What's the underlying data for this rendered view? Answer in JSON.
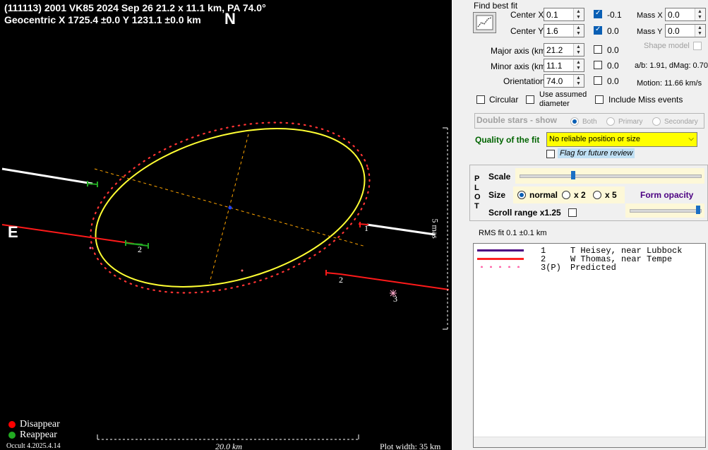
{
  "plot": {
    "title": "(111113) 2001 VK85  2024 Sep 26  21.2 x 11.1 km, PA 74.0°",
    "geocentric": "Geocentric  X  1725.4 ±0.0  Y 1231.1 ±0.0 km",
    "north_label": "N",
    "east_label": "E",
    "scale_label": "5 mas",
    "chord_labels": [
      "1",
      "2",
      "1",
      "2",
      "3"
    ],
    "legend_disappear": "Disappear",
    "legend_reappear": "Reappear",
    "version": "Occult 4.2025.4.14",
    "scale_bar_label": "20.0 km",
    "plot_width": "Plot width: 35 km",
    "colors": {
      "background": "#000000",
      "ellipse": "#ffff33",
      "chord1": "#ffffff",
      "chord2": "#ff1a1a",
      "predicted": "#ff3333",
      "axis_dash": "#ffa500",
      "disappear": "#ff0000",
      "reappear": "#22aa22"
    }
  },
  "panel": {
    "find_best_fit": "Find best fit",
    "center_x": {
      "label": "Center X",
      "value": "0.1",
      "check": true,
      "adj": "-0.1"
    },
    "center_y": {
      "label": "Center Y",
      "value": "1.6",
      "check": true,
      "adj": "0.0"
    },
    "mass_x": {
      "label": "Mass X",
      "value": "0.0"
    },
    "mass_y": {
      "label": "Mass Y",
      "value": "0.0"
    },
    "shape_model": "Shape model",
    "major_axis": {
      "label": "Major axis (km)",
      "value": "21.2",
      "check": false,
      "adj": "0.0"
    },
    "minor_axis": {
      "label": "Minor axis (km)",
      "value": "11.1",
      "check": false,
      "adj": "0.0"
    },
    "orientation": {
      "label": "Orientation",
      "value": "74.0",
      "check": false,
      "adj": "0.0"
    },
    "ab_dmag": "a/b: 1.91, dMag: 0.70",
    "motion": "Motion: 11.66 km/s",
    "circular": "Circular",
    "use_assumed_1": "Use assumed",
    "use_assumed_2": "diameter",
    "include_miss": "Include Miss events",
    "double_stars": "Double stars - show",
    "both": "Both",
    "primary": "Primary",
    "secondary": "Secondary",
    "quality_label": "Quality of the fit",
    "quality_value": "No reliable position or size",
    "flag_review": "Flag for future review",
    "plot_letters": [
      "P",
      "L",
      "O",
      "T"
    ],
    "scale": "Scale",
    "scale_slider_value": 0.29,
    "size": "Size",
    "normal": "normal",
    "x2": "x 2",
    "x5": "x 5",
    "form_opacity": "Form opacity",
    "opacity_slider_value": 1.0,
    "scroll_range": "Scroll range x1.25",
    "rms_fit": "RMS fit 0.1 ±0.1 km",
    "observers": [
      {
        "num": "1",
        "name": "T Heisey, near Lubbock",
        "color": "#4b0082",
        "style": "solid"
      },
      {
        "num": "2",
        "name": "W Thomas, near Tempe",
        "color": "#ff2222",
        "style": "solid"
      },
      {
        "num": "3(P)",
        "name": "Predicted",
        "color": "#ff66aa",
        "style": "dots"
      }
    ]
  }
}
